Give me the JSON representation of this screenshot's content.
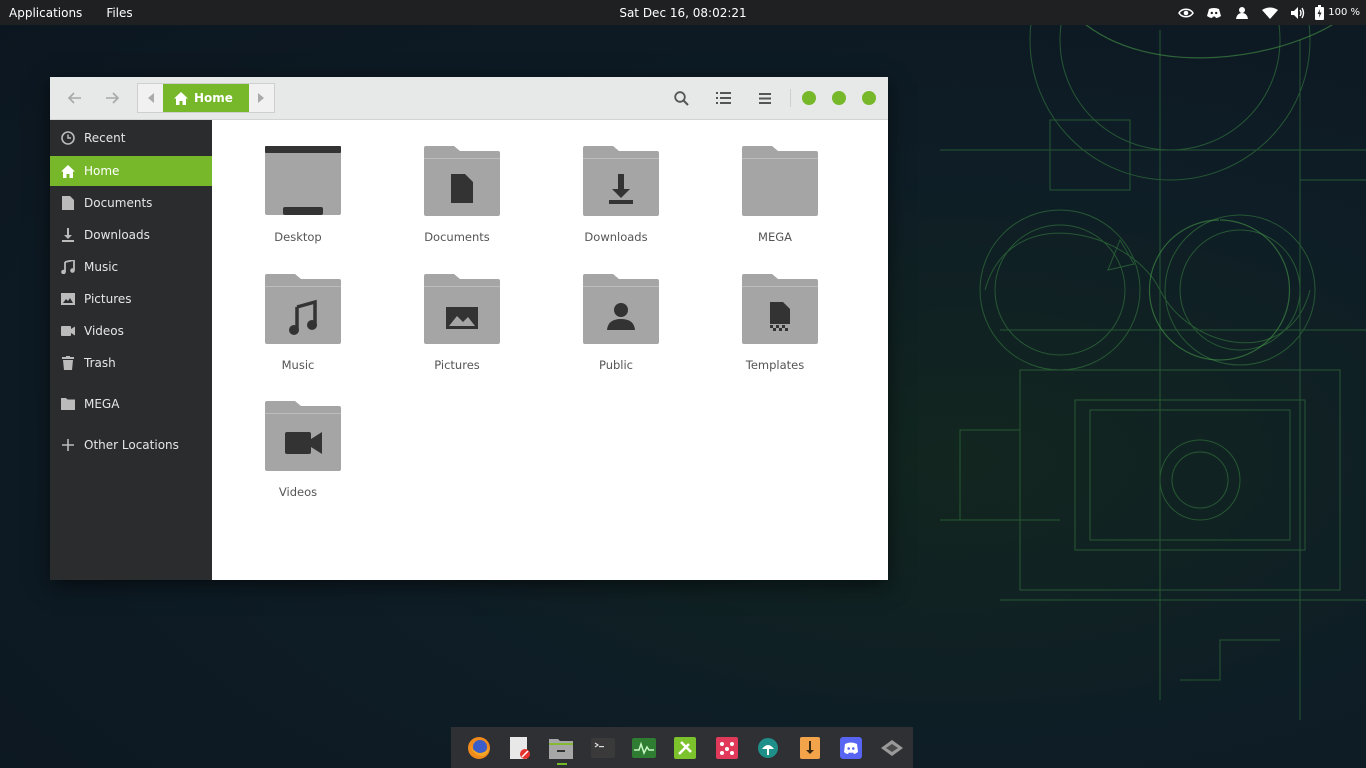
{
  "top_panel": {
    "applications_label": "Applications",
    "files_label": "Files",
    "clock": "Sat Dec 16, 08:02:21",
    "battery_percent": "100 %"
  },
  "window": {
    "path_label": "Home",
    "accent_color": "#76b82a"
  },
  "sidebar": {
    "items": [
      {
        "label": "Recent",
        "icon": "clock-icon"
      },
      {
        "label": "Home",
        "icon": "home-icon",
        "active": true
      },
      {
        "label": "Documents",
        "icon": "document-icon"
      },
      {
        "label": "Downloads",
        "icon": "download-icon"
      },
      {
        "label": "Music",
        "icon": "music-icon"
      },
      {
        "label": "Pictures",
        "icon": "picture-icon"
      },
      {
        "label": "Videos",
        "icon": "video-icon"
      },
      {
        "label": "Trash",
        "icon": "trash-icon"
      },
      {
        "label": "MEGA",
        "icon": "folder-icon"
      },
      {
        "label": "Other Locations",
        "icon": "plus-icon"
      }
    ]
  },
  "files": [
    {
      "label": "Desktop",
      "icon": "desktop-folder-icon"
    },
    {
      "label": "Documents",
      "icon": "documents-folder-icon"
    },
    {
      "label": "Downloads",
      "icon": "downloads-folder-icon"
    },
    {
      "label": "MEGA",
      "icon": "folder-icon"
    },
    {
      "label": "Music",
      "icon": "music-folder-icon"
    },
    {
      "label": "Pictures",
      "icon": "pictures-folder-icon"
    },
    {
      "label": "Public",
      "icon": "public-folder-icon"
    },
    {
      "label": "Templates",
      "icon": "templates-folder-icon"
    },
    {
      "label": "Videos",
      "icon": "videos-folder-icon"
    }
  ],
  "dock": {
    "items": [
      "firefox-icon",
      "text-editor-icon",
      "files-icon",
      "terminal-icon",
      "system-monitor-icon",
      "settings-tools-icon",
      "app-grid-icon",
      "software-updater-icon",
      "download-manager-icon",
      "discord-icon",
      "network-icon"
    ]
  }
}
